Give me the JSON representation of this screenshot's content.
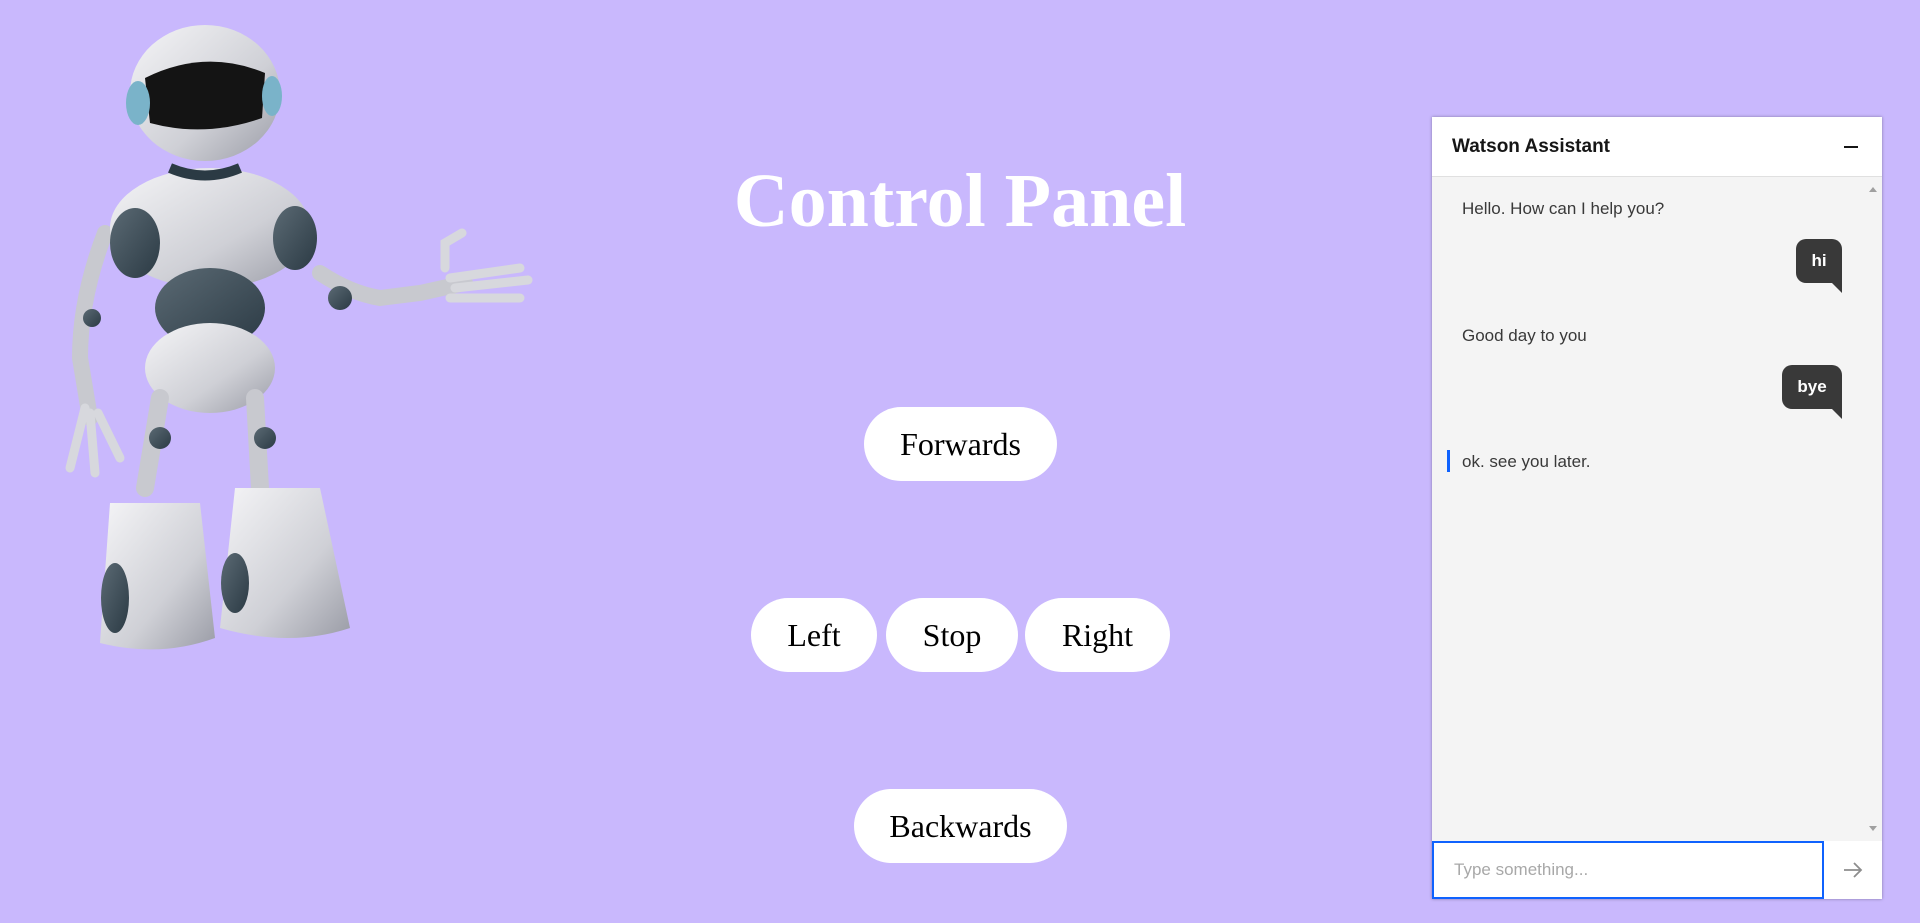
{
  "page": {
    "title": "Control Panel",
    "background_color": "#c9b8fd"
  },
  "illustration": {
    "name": "robot-illustration"
  },
  "controls": {
    "forwards": "Forwards",
    "left": "Left",
    "stop": "Stop",
    "right": "Right",
    "backwards": "Backwards"
  },
  "chat": {
    "title": "Watson Assistant",
    "minimize_icon": "minimize-icon",
    "messages": [
      {
        "from": "bot",
        "text": "Hello. How can I help you?"
      },
      {
        "from": "user",
        "text": "hi"
      },
      {
        "from": "bot",
        "text": "Good day to you"
      },
      {
        "from": "user",
        "text": "bye"
      },
      {
        "from": "bot",
        "text": "ok. see you later."
      }
    ],
    "input": {
      "placeholder": "Type something...",
      "value": ""
    },
    "send_icon": "arrow-right-icon",
    "accent_color": "#0f62fe",
    "user_bubble_color": "#393939"
  }
}
